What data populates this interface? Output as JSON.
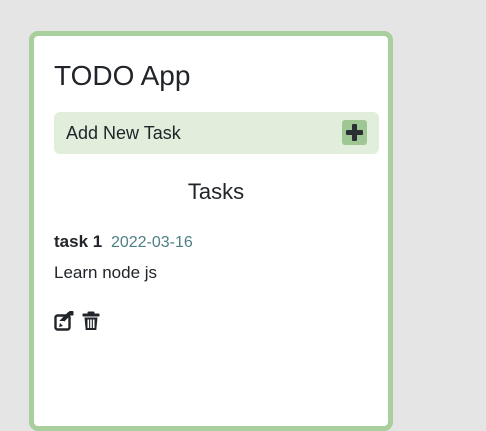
{
  "app": {
    "title": "TODO App"
  },
  "add_task": {
    "label": "Add New Task",
    "button_icon": "plus-icon"
  },
  "tasks_section": {
    "heading": "Tasks",
    "items": [
      {
        "name": "task 1",
        "date": "2022-03-16",
        "description": "Learn node js",
        "actions": [
          "edit-icon",
          "trash-icon"
        ]
      }
    ]
  },
  "colors": {
    "page_background": "#e5e5e5",
    "card_border": "#a8cf9c",
    "add_bar_background": "#e1eedc",
    "plus_button": "#9fc794",
    "date_text": "#4d7f86"
  }
}
